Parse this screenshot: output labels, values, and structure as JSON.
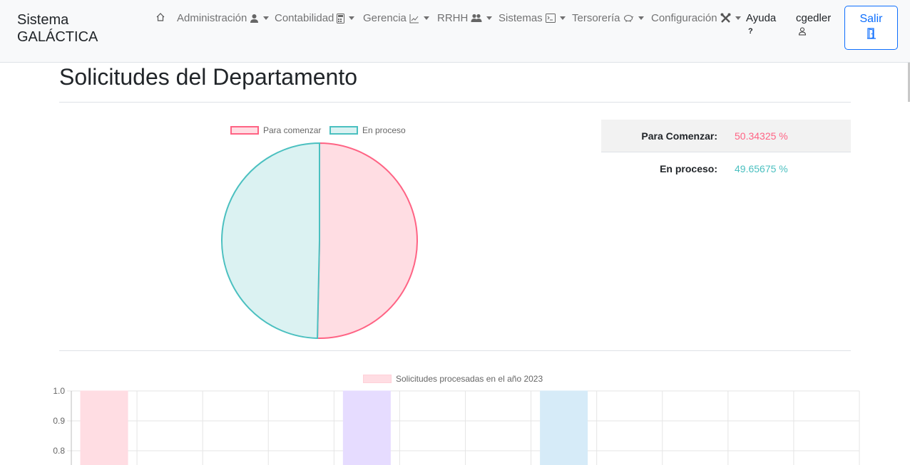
{
  "brand": {
    "line1": "Sistema",
    "line2": "GALÁCTICA"
  },
  "nav": {
    "home_icon": "house-icon",
    "items": [
      {
        "label": "Administración",
        "icon": "user-tie-icon"
      },
      {
        "label": "Contabilidad",
        "icon": "calculator-icon"
      },
      {
        "label": "Gerencia",
        "icon": "chart-line-icon"
      },
      {
        "label": "RRHH",
        "icon": "people-icon"
      },
      {
        "label": "Sistemas",
        "icon": "terminal-icon"
      },
      {
        "label": "Tersorería",
        "icon": "piggy-bank-icon"
      },
      {
        "label": "Configuración",
        "icon": "tools-icon"
      }
    ],
    "help": {
      "label": "Ayuda",
      "glyph": "?"
    },
    "user": {
      "label": "cgedler",
      "icon": "person-icon"
    },
    "logout": {
      "label": "Salir",
      "icon": "door-icon"
    }
  },
  "page": {
    "title": "Solicitudes del Departamento"
  },
  "stats": [
    {
      "label": "Para Comenzar:",
      "value": "50.34325 %",
      "color": "#ff6384"
    },
    {
      "label": "En proceso:",
      "value": "49.65675 %",
      "color": "#4bc0c0"
    }
  ],
  "chart_data": [
    {
      "type": "pie",
      "labels": [
        "Para comenzar",
        "En proceso"
      ],
      "values": [
        50.34325,
        49.65675
      ],
      "colors": {
        "fill": [
          "#ffdde3",
          "#dbf2f2"
        ],
        "stroke": [
          "#ff6384",
          "#4bc0c0"
        ]
      },
      "legend": "top"
    },
    {
      "type": "bar",
      "series": [
        {
          "name": "Solicitudes procesadas en el año 2023"
        }
      ],
      "categories": [
        "",
        "",
        "",
        "",
        "",
        "",
        "",
        "",
        "",
        "",
        "",
        ""
      ],
      "values": [
        1,
        0,
        0,
        0,
        1,
        0,
        0,
        1,
        0,
        0,
        0,
        0
      ],
      "bar_colors": [
        "#ffdde3",
        "#ffe9d6",
        "#fff4d6",
        "#dbf2f2",
        "#e6dcff",
        "#ebedef",
        "#ffdde3",
        "#d6ebf8",
        "#fff4d6",
        "#dbf2f2",
        "#e6dcff",
        "#ebedef"
      ],
      "yticks": [
        "1.0",
        "0.9",
        "0.8"
      ],
      "ylim": [
        0,
        1
      ],
      "grid": true,
      "legend": "top"
    }
  ]
}
